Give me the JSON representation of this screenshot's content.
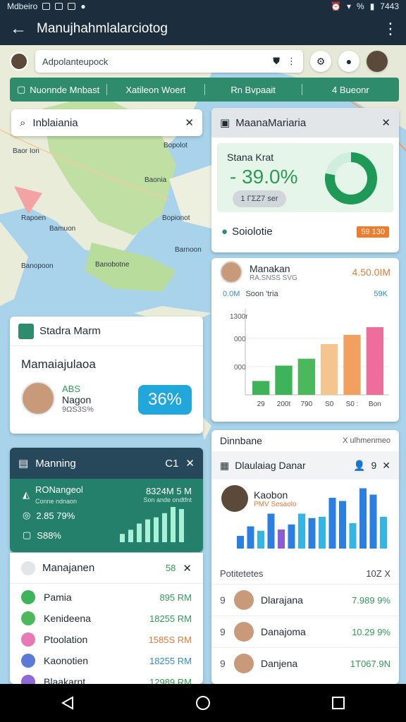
{
  "statusbar": {
    "carrier": "Mdbeiro",
    "time": "7443",
    "net": "%"
  },
  "appbar": {
    "title": "Manujhahmlalarciotog"
  },
  "search": {
    "value": "Adpolanteupock"
  },
  "tabs": [
    {
      "label": "Nuonnde Mnbast"
    },
    {
      "label": "Xatileon Woert"
    },
    {
      "label": "Rn Bvpaait"
    },
    {
      "label": "4 Bueonr"
    }
  ],
  "location": {
    "value": "Inblaiania"
  },
  "map_labels": [
    "Baor Ion",
    "Bopolot",
    "Baonia",
    "Rapoen",
    "Bamuon",
    "Bopionot",
    "Barnoon",
    "Banobotne",
    "Banopoon"
  ],
  "overview": {
    "title": "MaanaMariaria",
    "stat_label": "Stana Krat",
    "stat_value": "- 39.0%",
    "pill": "1 ΓΣΖ7 ser",
    "footer_label": "Soiolotie",
    "footer_badge": "59 130",
    "ring_pct": 78
  },
  "barcard": {
    "name": "Manakan",
    "sub": "RA.SNSS SVG",
    "amount": "4.50.0IM",
    "row_left": "0.0M",
    "row_mid": "Soon 'tria",
    "row_right": "59K",
    "y_ticks": [
      "1300r",
      "000",
      "000"
    ],
    "x_ticks": [
      "29",
      "200t",
      "790",
      "S0",
      "S0 :",
      "Bon"
    ]
  },
  "bar_chart": {
    "type": "bar",
    "categories": [
      "29",
      "200t",
      "790",
      "S0",
      "S0 :",
      "Bon"
    ],
    "values": [
      18,
      38,
      47,
      66,
      78,
      88
    ],
    "colors": [
      "#3fb35a",
      "#3fb35a",
      "#4cb85c",
      "#f5c58f",
      "#f2a060",
      "#ee6d9a"
    ],
    "ylim": [
      0,
      110
    ]
  },
  "profile": {
    "header": "Stadra Marm",
    "title": "Mamaiajulaoa",
    "tag": "ABS",
    "name": "Nagon",
    "code": "9ΩS3S%",
    "pct": "36%"
  },
  "darkcard": {
    "title": "Manning",
    "badge": "C1",
    "row1": "RONangeol",
    "row1_sub": "Conne ndnaon",
    "row2": "2.85 79%",
    "row3": "S88%",
    "right_value": "8324M 5 M",
    "right_sub": "Son ande ondtfnt",
    "mini_bars": [
      20,
      30,
      45,
      55,
      60,
      70,
      85,
      80
    ]
  },
  "list": {
    "header": "Manajanen",
    "header_value": "58",
    "items": [
      {
        "name": "Pamia",
        "value": "895 RM",
        "color": "#3fb35a",
        "vcolor": "#2e9a57"
      },
      {
        "name": "Kenideena",
        "value": "18255 RM",
        "color": "#4cb85c",
        "vcolor": "#2e9a57"
      },
      {
        "name": "Ptoolation",
        "value": "1585S RM",
        "color": "#e67ab4",
        "vcolor": "#e07a36"
      },
      {
        "name": "Kaonotien",
        "value": "18255 RM",
        "color": "#5b7bd6",
        "vcolor": "#2e8fc8"
      },
      {
        "name": "Blaakarnt",
        "value": "12989 RM",
        "color": "#8f6ad6",
        "vcolor": "#2e9a57"
      }
    ]
  },
  "rightcard": {
    "h1": "Dinnbane",
    "h1_sub": "X ulhmenmeo",
    "h2": "Dlaulaiag Danar",
    "h2_value": "9",
    "person_name": "Kaobon",
    "person_sub": "PMV Sesaolo",
    "mini_chart": [
      {
        "v": 20,
        "c": "#2a7fe0"
      },
      {
        "v": 35,
        "c": "#2a7fe0"
      },
      {
        "v": 28,
        "c": "#33b5e5"
      },
      {
        "v": 55,
        "c": "#2a7fe0"
      },
      {
        "v": 30,
        "c": "#8a5cd8"
      },
      {
        "v": 38,
        "c": "#2a7fe0"
      },
      {
        "v": 55,
        "c": "#33b5e5"
      },
      {
        "v": 48,
        "c": "#2a7fe0"
      },
      {
        "v": 50,
        "c": "#33b5e5"
      },
      {
        "v": 80,
        "c": "#2a7fe0"
      },
      {
        "v": 75,
        "c": "#2a7fe0"
      },
      {
        "v": 40,
        "c": "#33b5e5"
      },
      {
        "v": 95,
        "c": "#2a7fe0"
      },
      {
        "v": 85,
        "c": "#2a7fe0"
      },
      {
        "v": 50,
        "c": "#33b5e5"
      }
    ],
    "list_header": "Potitetetes",
    "list_header_right": "10Z X",
    "rows": [
      {
        "idx": "9",
        "name": "Dlarajana",
        "value": "7.989 9%"
      },
      {
        "idx": "9",
        "name": "Danajoma",
        "value": "10.29 9%"
      },
      {
        "idx": "9",
        "name": "Danjena",
        "value": "1T067.9N"
      }
    ]
  }
}
